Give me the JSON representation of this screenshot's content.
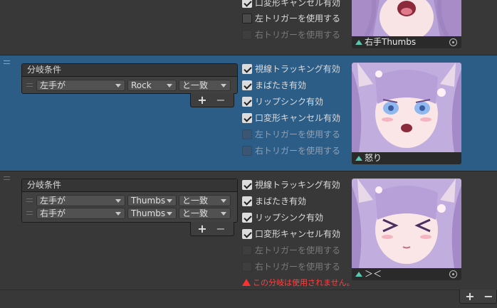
{
  "row1": {
    "checks": [
      {
        "label": "口変形キャンセル有効",
        "checked": true,
        "disabled": false
      },
      {
        "label": "左トリガーを使用する",
        "checked": false,
        "disabled": false
      },
      {
        "label": "右トリガーを使用する",
        "checked": false,
        "disabled": true
      }
    ],
    "thumb": {
      "caption": "右手Thumbs"
    }
  },
  "row2": {
    "cond_header": "分岐条件",
    "conditions": [
      {
        "hand": "左手が",
        "gesture": "Rock",
        "match": "と一致"
      }
    ],
    "checks": [
      {
        "label": "視線トラッキング有効",
        "checked": true,
        "disabled": false
      },
      {
        "label": "まばたき有効",
        "checked": true,
        "disabled": false
      },
      {
        "label": "リップシンク有効",
        "checked": true,
        "disabled": false
      },
      {
        "label": "口変形キャンセル有効",
        "checked": true,
        "disabled": false
      },
      {
        "label": "左トリガーを使用する",
        "checked": false,
        "disabled": true
      },
      {
        "label": "右トリガーを使用する",
        "checked": false,
        "disabled": true
      }
    ],
    "thumb": {
      "caption": "怒り"
    }
  },
  "row3": {
    "cond_header": "分岐条件",
    "conditions": [
      {
        "hand": "左手が",
        "gesture": "Thumbs",
        "match": "と一致"
      },
      {
        "hand": "右手が",
        "gesture": "Thumbs",
        "match": "と一致"
      }
    ],
    "checks": [
      {
        "label": "視線トラッキング有効",
        "checked": true,
        "disabled": false
      },
      {
        "label": "まばたき有効",
        "checked": true,
        "disabled": false
      },
      {
        "label": "リップシンク有効",
        "checked": true,
        "disabled": false
      },
      {
        "label": "口変形キャンセル有効",
        "checked": true,
        "disabled": false
      },
      {
        "label": "左トリガーを使用する",
        "checked": false,
        "disabled": true
      },
      {
        "label": "右トリガーを使用する",
        "checked": false,
        "disabled": true
      }
    ],
    "warning": "この分岐は使用されません。",
    "thumb": {
      "caption": "＞＜"
    }
  },
  "buttons": {
    "plus": "+",
    "minus": "−"
  },
  "colors": {
    "selected_row": "#2c5d87",
    "background": "#383838",
    "warning": "#ff4040",
    "accent_icon": "#58c8b0"
  },
  "icons": [
    "drag-handle-icon",
    "dropdown-arrow-icon",
    "checkmark-icon",
    "warning-icon",
    "avatar-icon",
    "object-picker-icon"
  ]
}
